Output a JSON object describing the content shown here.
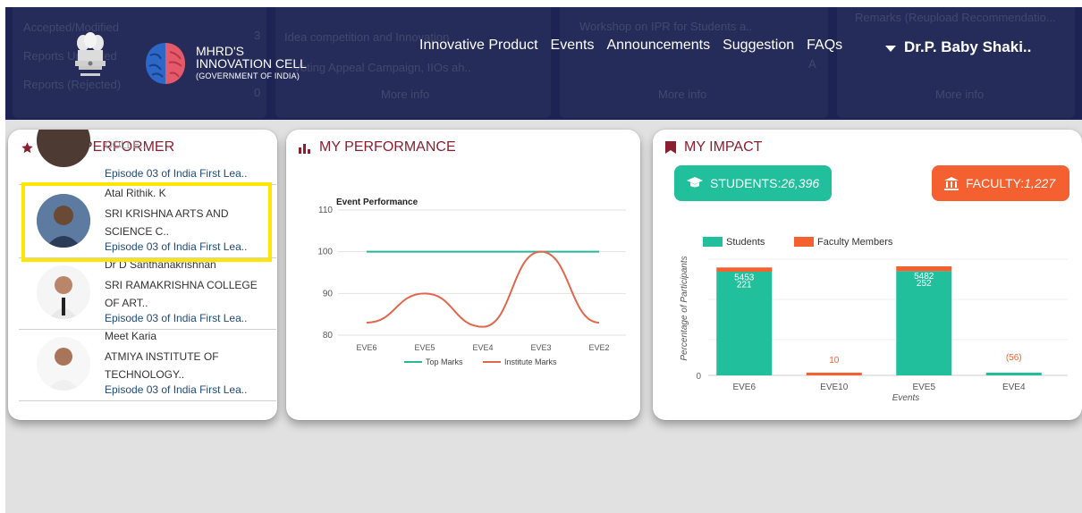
{
  "background_cards": {
    "left": [
      "Accepted/Modified",
      "Reports Uploaded",
      "Reports (Rejected)"
    ],
    "left_counts": [
      "3",
      "0"
    ],
    "middle": [
      "Idea competition and Innovation",
      "Voting Appeal Campaign, IIOs ah.."
    ],
    "middle_more": "More info",
    "right1": [
      "Workshop on IPR for Students a..",
      "A"
    ],
    "right1_more": "More info",
    "right2": [
      "Remarks (Reupload Recommendatio..."
    ],
    "right2_more": "More info"
  },
  "brand": {
    "line1": "MHRD'S",
    "line2": "INNOVATION CELL",
    "line3": "(GOVERNMENT OF INDIA)"
  },
  "nav": {
    "links": [
      "Innovative Product",
      "Events",
      "Announcements",
      "Suggestion",
      "FAQs"
    ],
    "user": "Dr.P. Baby Shaki.."
  },
  "star_performer": {
    "title": "STAR PERFORMER",
    "partial_item": {
      "college": "COLLE..",
      "episode": "Episode 03 of India First Lea.."
    },
    "items": [
      {
        "name": "Atal Rithik. K",
        "college": "SRI KRISHNA ARTS AND SCIENCE C..",
        "episode": "Episode 03 of India First Lea.."
      },
      {
        "name": "Dr D Santhanakrishnan",
        "college": "SRI RAMAKRISHNA COLLEGE OF ART..",
        "episode": "Episode 03 of India First Lea.."
      },
      {
        "name": "Meet Karia",
        "college": "ATMIYA INSTITUTE OF TECHNOLOGY..",
        "episode": "Episode 03 of India First Lea.."
      }
    ]
  },
  "my_performance": {
    "title": "MY PERFORMANCE",
    "colors": {
      "top": "#2bb59a",
      "institute": "#e0674b"
    }
  },
  "my_impact": {
    "title": "MY IMPACT",
    "students_label": "STUDENTS:",
    "students_value": "26,396",
    "faculty_label": "FACULTY:",
    "faculty_value": "1,227",
    "colors": {
      "students": "#22bf9c",
      "faculty": "#f4602f"
    }
  },
  "chart_data": [
    {
      "type": "line",
      "title": "Event Performance",
      "categories": [
        "EVE6",
        "EVE5",
        "EVE4",
        "EVE3",
        "EVE2"
      ],
      "ylim": [
        80,
        110
      ],
      "yticks": [
        80,
        90,
        100,
        110
      ],
      "series": [
        {
          "name": "Top Marks",
          "values": [
            100,
            100,
            100,
            100,
            100
          ]
        },
        {
          "name": "Institute Marks",
          "values": [
            83,
            90,
            82,
            100,
            83
          ]
        }
      ],
      "legend": "bottom"
    },
    {
      "type": "bar",
      "categories": [
        "EVE6",
        "EVE10",
        "EVE5",
        "EVE4"
      ],
      "xlabel": "Events",
      "ylabel": "Percentage of Participants",
      "series": [
        {
          "name": "Students",
          "values": [
            5453,
            0,
            5482,
            56
          ]
        },
        {
          "name": "Faculty Members",
          "values": [
            221,
            10,
            252,
            0
          ]
        }
      ],
      "stacked": true,
      "yticks": [
        0
      ],
      "legend": "top"
    }
  ]
}
